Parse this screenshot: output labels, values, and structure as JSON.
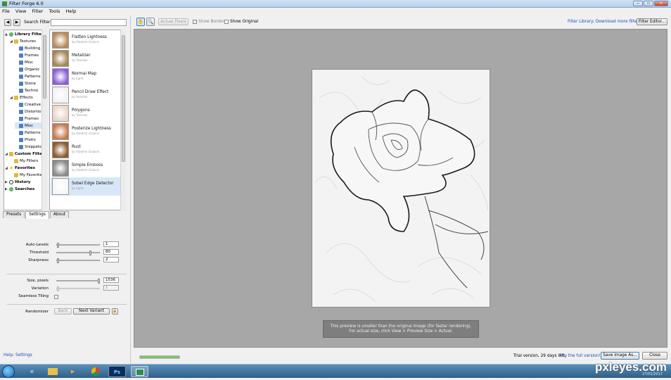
{
  "window": {
    "title": "Filter Forge 6.0",
    "min": "—",
    "max": "▭",
    "close": "✕"
  },
  "menu": [
    "File",
    "View",
    "Filter",
    "Tools",
    "Help"
  ],
  "search": {
    "label": "Search Filters:",
    "value": "",
    "back": "◀",
    "forward": "▶"
  },
  "tree": [
    {
      "label": "Library Filters",
      "icon": "globe-icon",
      "level": 0,
      "expander": "▲",
      "bold": true
    },
    {
      "label": "Textures",
      "icon": "folder-icon",
      "level": 1,
      "expander": "◢"
    },
    {
      "label": "Building",
      "icon": "category-icon",
      "level": 2
    },
    {
      "label": "Frames",
      "icon": "category-icon",
      "level": 2
    },
    {
      "label": "Misc",
      "icon": "category-icon",
      "level": 2
    },
    {
      "label": "Organic",
      "icon": "category-icon",
      "level": 2
    },
    {
      "label": "Patterns",
      "icon": "category-icon",
      "level": 2
    },
    {
      "label": "Stone",
      "icon": "category-icon",
      "level": 2
    },
    {
      "label": "Techno",
      "icon": "category-icon",
      "level": 2
    },
    {
      "label": "Effects",
      "icon": "folder-icon",
      "level": 1,
      "expander": "◢"
    },
    {
      "label": "Creative",
      "icon": "category-icon",
      "level": 2
    },
    {
      "label": "Distortions",
      "icon": "category-icon",
      "level": 2
    },
    {
      "label": "Frames",
      "icon": "category-icon",
      "level": 2
    },
    {
      "label": "Misc",
      "icon": "category-icon",
      "level": 2,
      "selected": true
    },
    {
      "label": "Patterns",
      "icon": "category-icon",
      "level": 2
    },
    {
      "label": "Photo",
      "icon": "category-icon",
      "level": 2
    },
    {
      "label": "Snippets",
      "icon": "category-icon",
      "level": 2
    },
    {
      "label": "Custom Filters",
      "icon": "custom-filters-icon",
      "level": 0,
      "expander": "◢",
      "bold": true
    },
    {
      "label": "My Filters",
      "icon": "folder-icon",
      "level": 1
    },
    {
      "label": "Favorites",
      "icon": "star-icon",
      "level": 0,
      "expander": "◢",
      "bold": true
    },
    {
      "label": "My Favorites",
      "icon": "folder-icon",
      "level": 1
    },
    {
      "label": "History",
      "icon": "clock-icon",
      "level": 0,
      "expander": "▶",
      "bold": true
    },
    {
      "label": "Searches",
      "icon": "globe-icon",
      "level": 0,
      "expander": "▶",
      "bold": true
    }
  ],
  "filters": [
    {
      "name": "Flatten Lightness",
      "author": "by Vladimir Golovin",
      "thumb": "#b88a5c"
    },
    {
      "name": "Metalizer",
      "author": "by Yaroslav",
      "thumb": "#a48554"
    },
    {
      "name": "Normal Map",
      "author": "by Egret",
      "thumb": "#8a5fd6"
    },
    {
      "name": "Pencil Draw Effect",
      "author": "by Yaroslav",
      "thumb": "#f2f2f2"
    },
    {
      "name": "Polygons",
      "author": "by Yaroslav",
      "thumb": "#e9d6c8"
    },
    {
      "name": "Posterize Lightness",
      "author": "by Vladimir Golovin",
      "thumb": "#c8794a"
    },
    {
      "name": "Rust",
      "author": "by Vladimir Golovin",
      "thumb": "#8c5a2e"
    },
    {
      "name": "Simple Emboss",
      "author": "by Vladimir Golovin",
      "thumb": "#8a8a8a"
    },
    {
      "name": "Sobel Edge Detector",
      "author": "by Egret",
      "thumb": "#f6f6f6",
      "selected": true
    }
  ],
  "tabs": [
    "Presets",
    "Settings",
    "About"
  ],
  "settings": {
    "auto_levels": {
      "label": "Auto-Levels",
      "value": "1",
      "pos": 0
    },
    "threshold": {
      "label": "Threshold",
      "value": "80",
      "pos": 0.8
    },
    "sharpness": {
      "label": "Sharpness",
      "value": "2",
      "pos": 0
    },
    "size": {
      "label": "Size, pixels",
      "value": "1536",
      "pos": 1
    },
    "variation": {
      "label": "Variation",
      "value": "1",
      "pos": 0
    },
    "seamless": {
      "label": "Seamless Tiling"
    },
    "randomizer": {
      "label": "Randomizer",
      "back": "Back",
      "next": "Next Variant",
      "lock": "🔒"
    }
  },
  "help_link": "Help: Settings",
  "toolbar": {
    "actual_pixels": "Actual Pixels",
    "show_border": "Show Border",
    "show_original": "Show Original",
    "library_link": "Filter Library: Download more filters",
    "filter_editor": "Filter Editor..."
  },
  "preview_notice": {
    "line1": "This preview is smaller than the original image (for faster rendering).",
    "line2": "For actual size, click View > Preview Size > Actual."
  },
  "status": {
    "progress": 1.0,
    "trial": "Trial version, 29 days left.",
    "buy_link": "Buy the full version!",
    "save_button": "Save Image As...",
    "close_button": "Close"
  },
  "taskbar": {
    "apps": [
      "windows-explorer-icon",
      "internet-explorer-icon",
      "folder-icon",
      "media-player-icon",
      "chrome-icon",
      "photoshop-icon",
      "filter-forge-icon"
    ],
    "ps_label": "Ps"
  },
  "watermark": {
    "brand": "pxleyes.com",
    "date": "27/01/2017"
  },
  "colors": {
    "accent_link": "#1b4fb8",
    "selection": "#d8e7f8",
    "preview_bg": "#a7a7a7"
  }
}
